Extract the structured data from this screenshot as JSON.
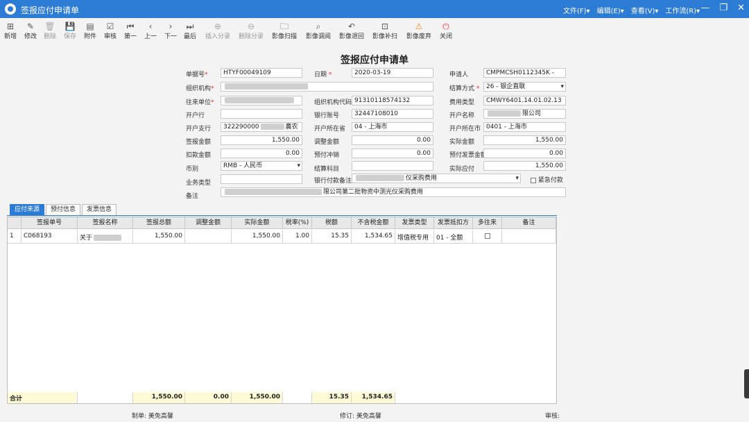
{
  "window": {
    "title": "签报应付申请单",
    "menus": [
      "文件(F)▾",
      "编辑(E)▾",
      "查看(V)▾",
      "工作流(R)▾"
    ],
    "controls": [
      "—",
      "❐",
      "✕"
    ]
  },
  "toolbar": [
    {
      "id": "new",
      "label": "新增",
      "icon": "⊞",
      "disabled": false
    },
    {
      "id": "edit",
      "label": "修改",
      "icon": "✎",
      "disabled": false
    },
    {
      "id": "delete",
      "label": "删除",
      "icon": "🗑",
      "disabled": true
    },
    {
      "id": "save",
      "label": "保存",
      "icon": "💾",
      "disabled": true
    },
    {
      "id": "attach",
      "label": "附件",
      "icon": "▤",
      "disabled": false
    },
    {
      "id": "audit",
      "label": "审核",
      "icon": "☑",
      "disabled": false
    },
    {
      "id": "first",
      "label": "第一",
      "icon": "⏮",
      "disabled": false
    },
    {
      "id": "prev",
      "label": "上一",
      "icon": "‹",
      "disabled": false
    },
    {
      "id": "next",
      "label": "下一",
      "icon": "›",
      "disabled": false
    },
    {
      "id": "last",
      "label": "最后",
      "icon": "⏭",
      "disabled": false
    },
    {
      "id": "insert-split",
      "label": "插入分录",
      "icon": "⊕",
      "disabled": true
    },
    {
      "id": "delete-split",
      "label": "删除分录",
      "icon": "⊖",
      "disabled": true
    },
    {
      "id": "image-scan",
      "label": "影像扫描",
      "icon": "🗀",
      "disabled": false
    },
    {
      "id": "image-view",
      "label": "影像调阅",
      "icon": "⌕",
      "disabled": false
    },
    {
      "id": "image-return",
      "label": "影像退回",
      "icon": "↶",
      "disabled": false
    },
    {
      "id": "image-rescan",
      "label": "影像补扫",
      "icon": "⊡",
      "disabled": false
    },
    {
      "id": "image-void",
      "label": "影像废弃",
      "icon": "⚠",
      "disabled": false
    },
    {
      "id": "close",
      "label": "关闭",
      "icon": "⏻",
      "disabled": false
    }
  ],
  "form": {
    "title": "签报应付申请单",
    "labels": {
      "doc_no": "单据号",
      "date": "日期",
      "applicant": "申请人",
      "org": "组织机构",
      "settle_method": "结算方式",
      "partner": "往来单位",
      "org_code": "组织机构代码",
      "cost_type": "费用类型",
      "bank": "开户行",
      "bank_account": "银行账号",
      "account_name": "开户名称",
      "branch": "开户支行",
      "province": "开户所在省",
      "city": "开户所在市",
      "sign_amount": "签报金额",
      "adjust_amount": "调整金额",
      "actual_amount": "实际金额",
      "deduct_amount": "扣款金额",
      "prepay_offset": "预付冲销",
      "prepay_invoice_amount": "预付发票金额",
      "currency": "币别",
      "settle_subject": "结算科目",
      "actual_payable": "实际应付",
      "biz_type": "业务类型",
      "bank_remark": "银行付款备注",
      "urgent": "紧急付款",
      "remark": "备注"
    },
    "values": {
      "doc_no": "HTYF00049109",
      "date": "2020-03-19",
      "applicant": "CMPMCSH0112345K -",
      "settle_method": "26 - 银企直联",
      "org_code": "91310118574132",
      "cost_type": "CMWY6401.14.01.02.13",
      "bank_account": "32447108010",
      "account_name": "限公司",
      "branch": "322290000",
      "branch_tail": "農农",
      "province": "04 - 上海市",
      "city": "0401 - 上海市",
      "sign_amount": "1,550.00",
      "adjust_amount": "0.00",
      "actual_amount": "1,550.00",
      "deduct_amount": "0.00",
      "prepay_offset": "0.00",
      "prepay_invoice_amount": "0.00",
      "currency": "RMB - 人民币",
      "actual_payable": "1,550.00",
      "bank_remark": "仪采购费用",
      "remark": "限公司第二批物资中测光仪采购费用"
    }
  },
  "tabs": [
    "应付来源",
    "预付信息",
    "发票信息"
  ],
  "grid": {
    "columns": [
      "",
      "签报单号",
      "签报名称",
      "签报总额",
      "调整金额",
      "实际金额",
      "税率(%)",
      "税额",
      "不含税金额",
      "发票类型",
      "发票抵扣方",
      "多往来",
      "备注"
    ],
    "rows": [
      {
        "no": "1",
        "sign_no": "C068193",
        "sign_name": "关于",
        "total": "1,550.00",
        "adjust": "",
        "actual": "1,550.00",
        "tax_rate": "1.00",
        "tax": "15.35",
        "net": "1,534.65",
        "invoice_type": "增值税专用",
        "deduct": "01 - 全额",
        "multi": false,
        "remark": ""
      }
    ],
    "totals": {
      "label": "合计",
      "total": "1,550.00",
      "adjust": "0.00",
      "actual": "1,550.00",
      "tax": "15.35",
      "net": "1,534.65"
    }
  },
  "footer": {
    "maker_label": "制单:",
    "maker": "美免高馨",
    "modifier_label": "修订:",
    "modifier": "美免高馨",
    "auditor_label": "审核:"
  }
}
